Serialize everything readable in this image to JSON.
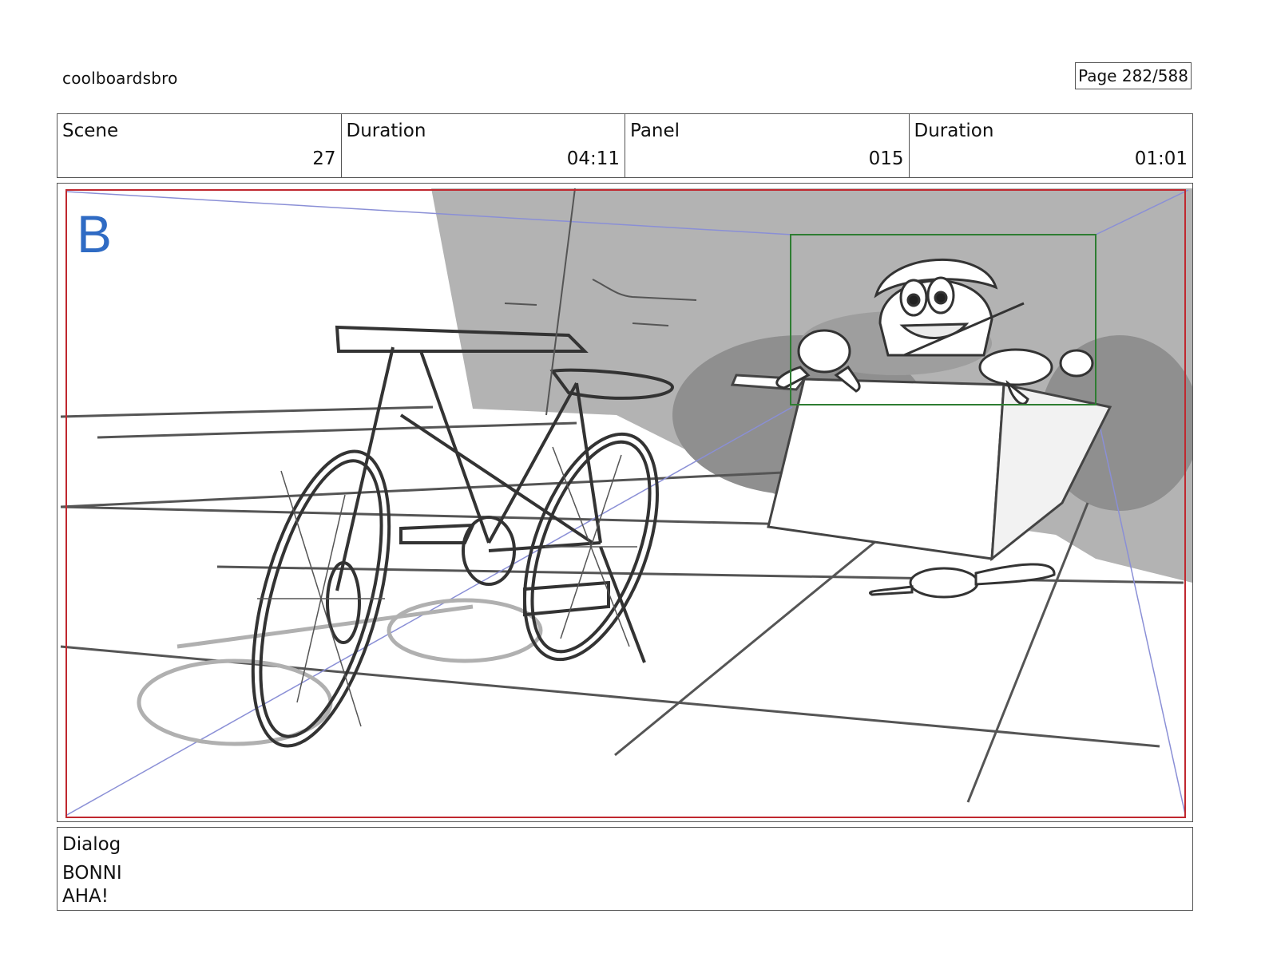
{
  "header": {
    "project": "coolboardsbro",
    "page_label": "Page 282/588"
  },
  "info": [
    {
      "label": "Scene",
      "value": "27"
    },
    {
      "label": "Duration",
      "value": "04:11"
    },
    {
      "label": "Panel",
      "value": "015"
    },
    {
      "label": "Duration",
      "value": "01:01"
    }
  ],
  "panel": {
    "marker_letter": "B",
    "colors": {
      "safe_frame": "#c0282f",
      "focus_box": "#2e7d32",
      "marker": "#2f6bc4",
      "perspective_lines": "#8a8fd6",
      "wall_shadow": "#b3b3b3",
      "dark_shadow": "#8f8f8f"
    },
    "subjects": [
      "bicycle",
      "box",
      "character-bonni",
      "stuffed-toy-bunny",
      "stuffed-toy-bug"
    ]
  },
  "dialog": {
    "label": "Dialog",
    "speaker": "BONNI",
    "line": "AHA!"
  }
}
